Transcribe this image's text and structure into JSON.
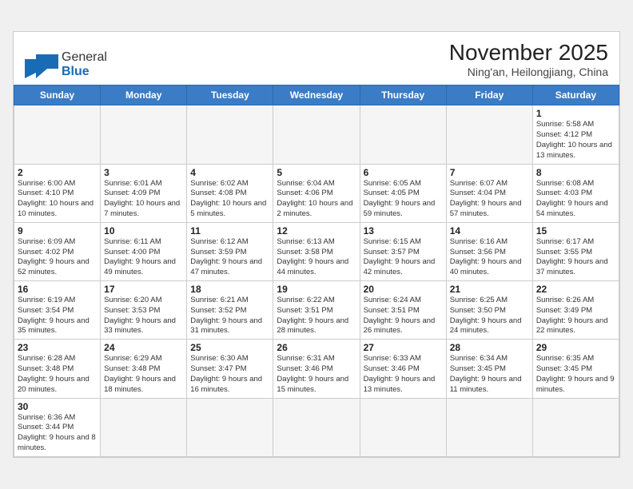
{
  "header": {
    "logo_line1": "General",
    "logo_line2": "Blue",
    "month": "November 2025",
    "location": "Ning'an, Heilongjiang, China"
  },
  "weekdays": [
    "Sunday",
    "Monday",
    "Tuesday",
    "Wednesday",
    "Thursday",
    "Friday",
    "Saturday"
  ],
  "weeks": [
    [
      {
        "day": "",
        "info": ""
      },
      {
        "day": "",
        "info": ""
      },
      {
        "day": "",
        "info": ""
      },
      {
        "day": "",
        "info": ""
      },
      {
        "day": "",
        "info": ""
      },
      {
        "day": "",
        "info": ""
      },
      {
        "day": "1",
        "info": "Sunrise: 5:58 AM\nSunset: 4:12 PM\nDaylight: 10 hours\nand 13 minutes."
      }
    ],
    [
      {
        "day": "2",
        "info": "Sunrise: 6:00 AM\nSunset: 4:10 PM\nDaylight: 10 hours\nand 10 minutes."
      },
      {
        "day": "3",
        "info": "Sunrise: 6:01 AM\nSunset: 4:09 PM\nDaylight: 10 hours\nand 7 minutes."
      },
      {
        "day": "4",
        "info": "Sunrise: 6:02 AM\nSunset: 4:08 PM\nDaylight: 10 hours\nand 5 minutes."
      },
      {
        "day": "5",
        "info": "Sunrise: 6:04 AM\nSunset: 4:06 PM\nDaylight: 10 hours\nand 2 minutes."
      },
      {
        "day": "6",
        "info": "Sunrise: 6:05 AM\nSunset: 4:05 PM\nDaylight: 9 hours\nand 59 minutes."
      },
      {
        "day": "7",
        "info": "Sunrise: 6:07 AM\nSunset: 4:04 PM\nDaylight: 9 hours\nand 57 minutes."
      },
      {
        "day": "8",
        "info": "Sunrise: 6:08 AM\nSunset: 4:03 PM\nDaylight: 9 hours\nand 54 minutes."
      }
    ],
    [
      {
        "day": "9",
        "info": "Sunrise: 6:09 AM\nSunset: 4:02 PM\nDaylight: 9 hours\nand 52 minutes."
      },
      {
        "day": "10",
        "info": "Sunrise: 6:11 AM\nSunset: 4:00 PM\nDaylight: 9 hours\nand 49 minutes."
      },
      {
        "day": "11",
        "info": "Sunrise: 6:12 AM\nSunset: 3:59 PM\nDaylight: 9 hours\nand 47 minutes."
      },
      {
        "day": "12",
        "info": "Sunrise: 6:13 AM\nSunset: 3:58 PM\nDaylight: 9 hours\nand 44 minutes."
      },
      {
        "day": "13",
        "info": "Sunrise: 6:15 AM\nSunset: 3:57 PM\nDaylight: 9 hours\nand 42 minutes."
      },
      {
        "day": "14",
        "info": "Sunrise: 6:16 AM\nSunset: 3:56 PM\nDaylight: 9 hours\nand 40 minutes."
      },
      {
        "day": "15",
        "info": "Sunrise: 6:17 AM\nSunset: 3:55 PM\nDaylight: 9 hours\nand 37 minutes."
      }
    ],
    [
      {
        "day": "16",
        "info": "Sunrise: 6:19 AM\nSunset: 3:54 PM\nDaylight: 9 hours\nand 35 minutes."
      },
      {
        "day": "17",
        "info": "Sunrise: 6:20 AM\nSunset: 3:53 PM\nDaylight: 9 hours\nand 33 minutes."
      },
      {
        "day": "18",
        "info": "Sunrise: 6:21 AM\nSunset: 3:52 PM\nDaylight: 9 hours\nand 31 minutes."
      },
      {
        "day": "19",
        "info": "Sunrise: 6:22 AM\nSunset: 3:51 PM\nDaylight: 9 hours\nand 28 minutes."
      },
      {
        "day": "20",
        "info": "Sunrise: 6:24 AM\nSunset: 3:51 PM\nDaylight: 9 hours\nand 26 minutes."
      },
      {
        "day": "21",
        "info": "Sunrise: 6:25 AM\nSunset: 3:50 PM\nDaylight: 9 hours\nand 24 minutes."
      },
      {
        "day": "22",
        "info": "Sunrise: 6:26 AM\nSunset: 3:49 PM\nDaylight: 9 hours\nand 22 minutes."
      }
    ],
    [
      {
        "day": "23",
        "info": "Sunrise: 6:28 AM\nSunset: 3:48 PM\nDaylight: 9 hours\nand 20 minutes."
      },
      {
        "day": "24",
        "info": "Sunrise: 6:29 AM\nSunset: 3:48 PM\nDaylight: 9 hours\nand 18 minutes."
      },
      {
        "day": "25",
        "info": "Sunrise: 6:30 AM\nSunset: 3:47 PM\nDaylight: 9 hours\nand 16 minutes."
      },
      {
        "day": "26",
        "info": "Sunrise: 6:31 AM\nSunset: 3:46 PM\nDaylight: 9 hours\nand 15 minutes."
      },
      {
        "day": "27",
        "info": "Sunrise: 6:33 AM\nSunset: 3:46 PM\nDaylight: 9 hours\nand 13 minutes."
      },
      {
        "day": "28",
        "info": "Sunrise: 6:34 AM\nSunset: 3:45 PM\nDaylight: 9 hours\nand 11 minutes."
      },
      {
        "day": "29",
        "info": "Sunrise: 6:35 AM\nSunset: 3:45 PM\nDaylight: 9 hours\nand 9 minutes."
      }
    ],
    [
      {
        "day": "30",
        "info": "Sunrise: 6:36 AM\nSunset: 3:44 PM\nDaylight: 9 hours\nand 8 minutes."
      },
      {
        "day": "",
        "info": ""
      },
      {
        "day": "",
        "info": ""
      },
      {
        "day": "",
        "info": ""
      },
      {
        "day": "",
        "info": ""
      },
      {
        "day": "",
        "info": ""
      },
      {
        "day": "",
        "info": ""
      }
    ]
  ]
}
